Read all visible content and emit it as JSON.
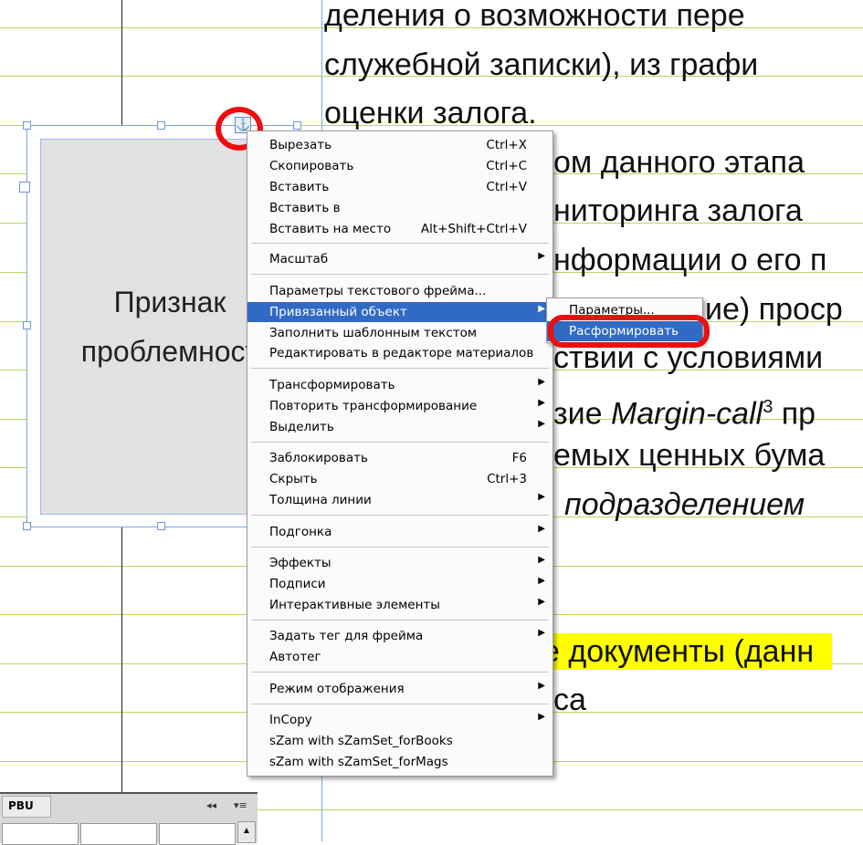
{
  "document": {
    "lines": [
      "деления о возможности пере",
      "служебной записки), из графи",
      "оценки залога.",
      "ом данного этапа",
      "ниторинга залога",
      "нформации о его п",
      "ие) проср",
      "ствии с условиями",
      "зие ",
      "емых ценных бума",
      "подразделением",
      "е документы (данн",
      "са"
    ],
    "margin_call_italic": "Margin-call",
    "margin_call_sup": "3",
    "margin_call_tail": " пр",
    "highlight_color": "#ffff00"
  },
  "frame": {
    "label_line1": "Признак",
    "label_line2": "проблемност"
  },
  "context_menu": {
    "cut": {
      "label": "Вырезать",
      "shortcut": "Ctrl+X"
    },
    "copy": {
      "label": "Скопировать",
      "shortcut": "Ctrl+C"
    },
    "paste": {
      "label": "Вставить",
      "shortcut": "Ctrl+V"
    },
    "paste_into": {
      "label": "Вставить в"
    },
    "paste_in_place": {
      "label": "Вставить на место",
      "shortcut": "Alt+Shift+Ctrl+V"
    },
    "zoom": {
      "label": "Масштаб"
    },
    "text_frame_options": {
      "label": "Параметры текстового фрейма..."
    },
    "anchored_object": {
      "label": "Привязанный объект"
    },
    "fill_placeholder": {
      "label": "Заполнить шаблонным текстом"
    },
    "edit_in_story_editor": {
      "label": "Редактировать в редакторе материалов"
    },
    "transform": {
      "label": "Трансформировать"
    },
    "transform_again": {
      "label": "Повторить трансформирование"
    },
    "select": {
      "label": "Выделить"
    },
    "lock": {
      "label": "Заблокировать",
      "shortcut": "F6"
    },
    "hide": {
      "label": "Скрыть",
      "shortcut": "Ctrl+3"
    },
    "stroke_weight": {
      "label": "Толщина линии"
    },
    "fitting": {
      "label": "Подгонка"
    },
    "effects": {
      "label": "Эффекты"
    },
    "captions": {
      "label": "Подписи"
    },
    "interactive": {
      "label": "Интерактивные элементы"
    },
    "tag_frame": {
      "label": "Задать тег для фрейма"
    },
    "autotag": {
      "label": "Автотег"
    },
    "display_performance": {
      "label": "Режим отображения"
    },
    "incopy": {
      "label": "InCopy"
    },
    "szam_books": {
      "label": "sZam with sZamSet_forBooks"
    },
    "szam_mags": {
      "label": "sZam with sZamSet_forMags"
    }
  },
  "submenu": {
    "options": {
      "label": "Параметры..."
    },
    "release": {
      "label": "Расформировать"
    }
  },
  "panel": {
    "tab_label": "PBU",
    "collapse_glyph": "◂◂",
    "menu_glyph": "▾≡"
  },
  "colors": {
    "highlight": "#316ac5",
    "annotation_red": "#ee0e0e",
    "baseline_grid": "#b6d85a",
    "frame_edge": "#7ea5e6"
  }
}
